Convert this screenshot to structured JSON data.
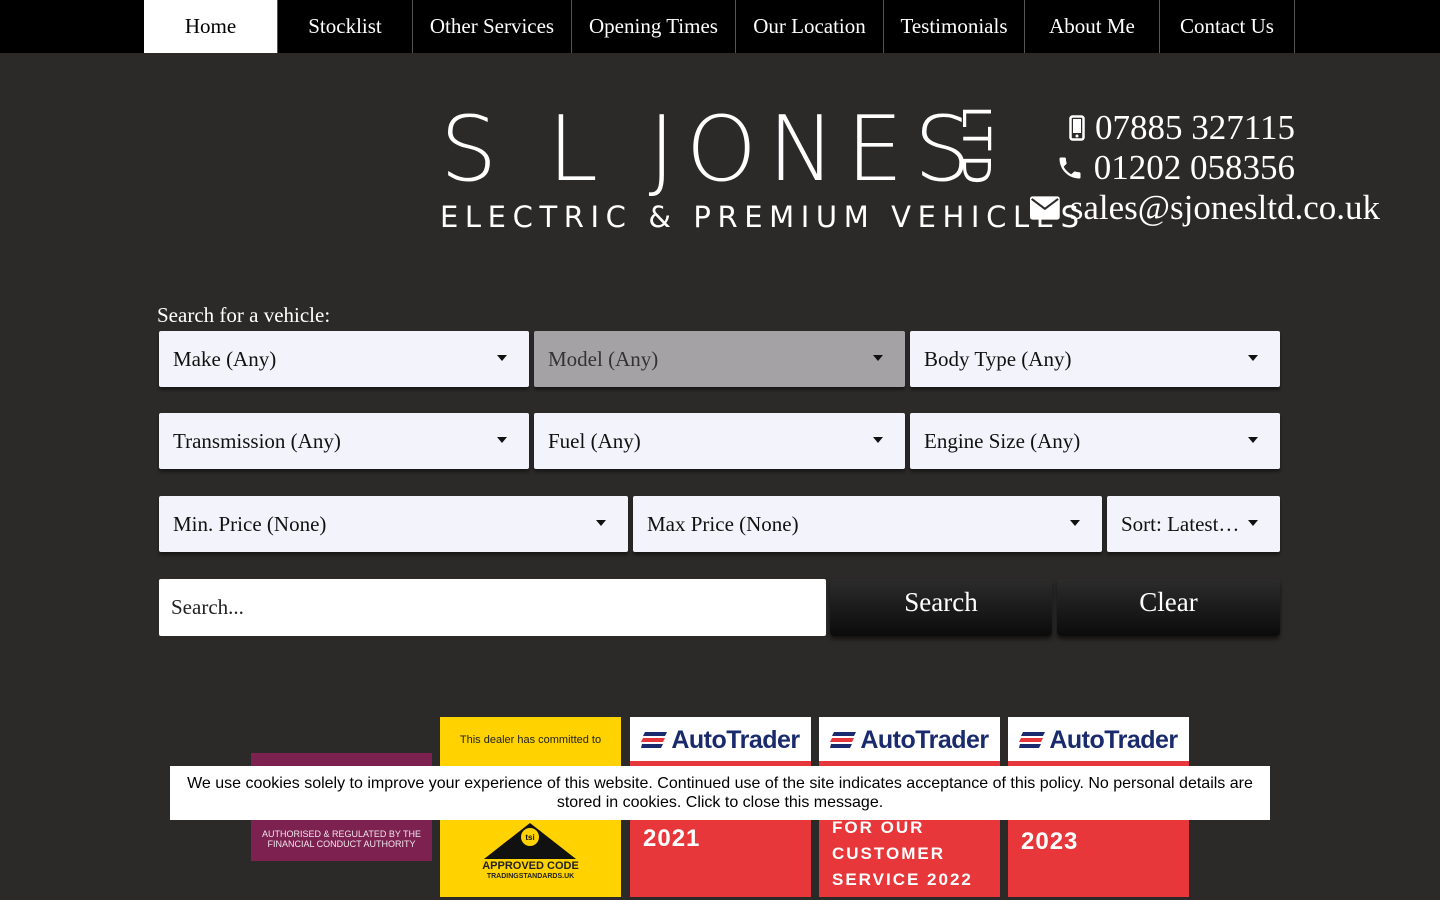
{
  "nav": {
    "items": [
      {
        "label": "Home",
        "width": 134,
        "active": true
      },
      {
        "label": "Stocklist",
        "width": 135
      },
      {
        "label": "Other Services",
        "width": 159
      },
      {
        "label": "Opening Times",
        "width": 164
      },
      {
        "label": "Our Location",
        "width": 148
      },
      {
        "label": "Testimonials",
        "width": 141
      },
      {
        "label": "About Me",
        "width": 135
      },
      {
        "label": "Contact Us",
        "width": 135
      }
    ]
  },
  "brand": {
    "name": "S L JONES",
    "suffix": "LTD",
    "tagline": "ELECTRIC & PREMIUM VEHICLES"
  },
  "contact": {
    "mobile": "07885 327115",
    "phone": "01202 058356",
    "email": "sales@sjonesltd.co.uk"
  },
  "search": {
    "label": "Search for a vehicle:",
    "make": "Make (Any)",
    "model": "Model (Any)",
    "body_type": "Body Type (Any)",
    "transmission": "Transmission (Any)",
    "fuel": "Fuel (Any)",
    "engine_size": "Engine Size (Any)",
    "min_price": "Min. Price (None)",
    "max_price": "Max Price (None)",
    "sort": "Sort: Latest…",
    "input_placeholder": "Search...",
    "search_button": "Search",
    "clear_button": "Clear"
  },
  "badges": {
    "fca_text": "AUTHORISED & REGULATED BY THE FINANCIAL CONDUCT AUTHORITY",
    "tsi_top": "This dealer has committed to",
    "tsi_code": "APPROVED CODE",
    "tsi_url": "TRADINGSTANDARDS.UK",
    "tsi_logo": "tsi",
    "autotrader_name": "AutoTrader",
    "at1_year": "2021",
    "at2_lines": [
      "FOR OUR",
      "CUSTOMER",
      "SERVICE 2022"
    ],
    "at3_year": "2023"
  },
  "cookie": {
    "message": "We use cookies solely to improve your experience of this website. Continued use of the site indicates acceptance of this policy. No personal details are stored in cookies. Click to close this message."
  },
  "colors": {
    "background": "#2c2a29",
    "nav": "#000000",
    "autotrader_red": "#e8373a",
    "tsi_yellow": "#ffd200",
    "fca_purple": "#7c2150"
  }
}
